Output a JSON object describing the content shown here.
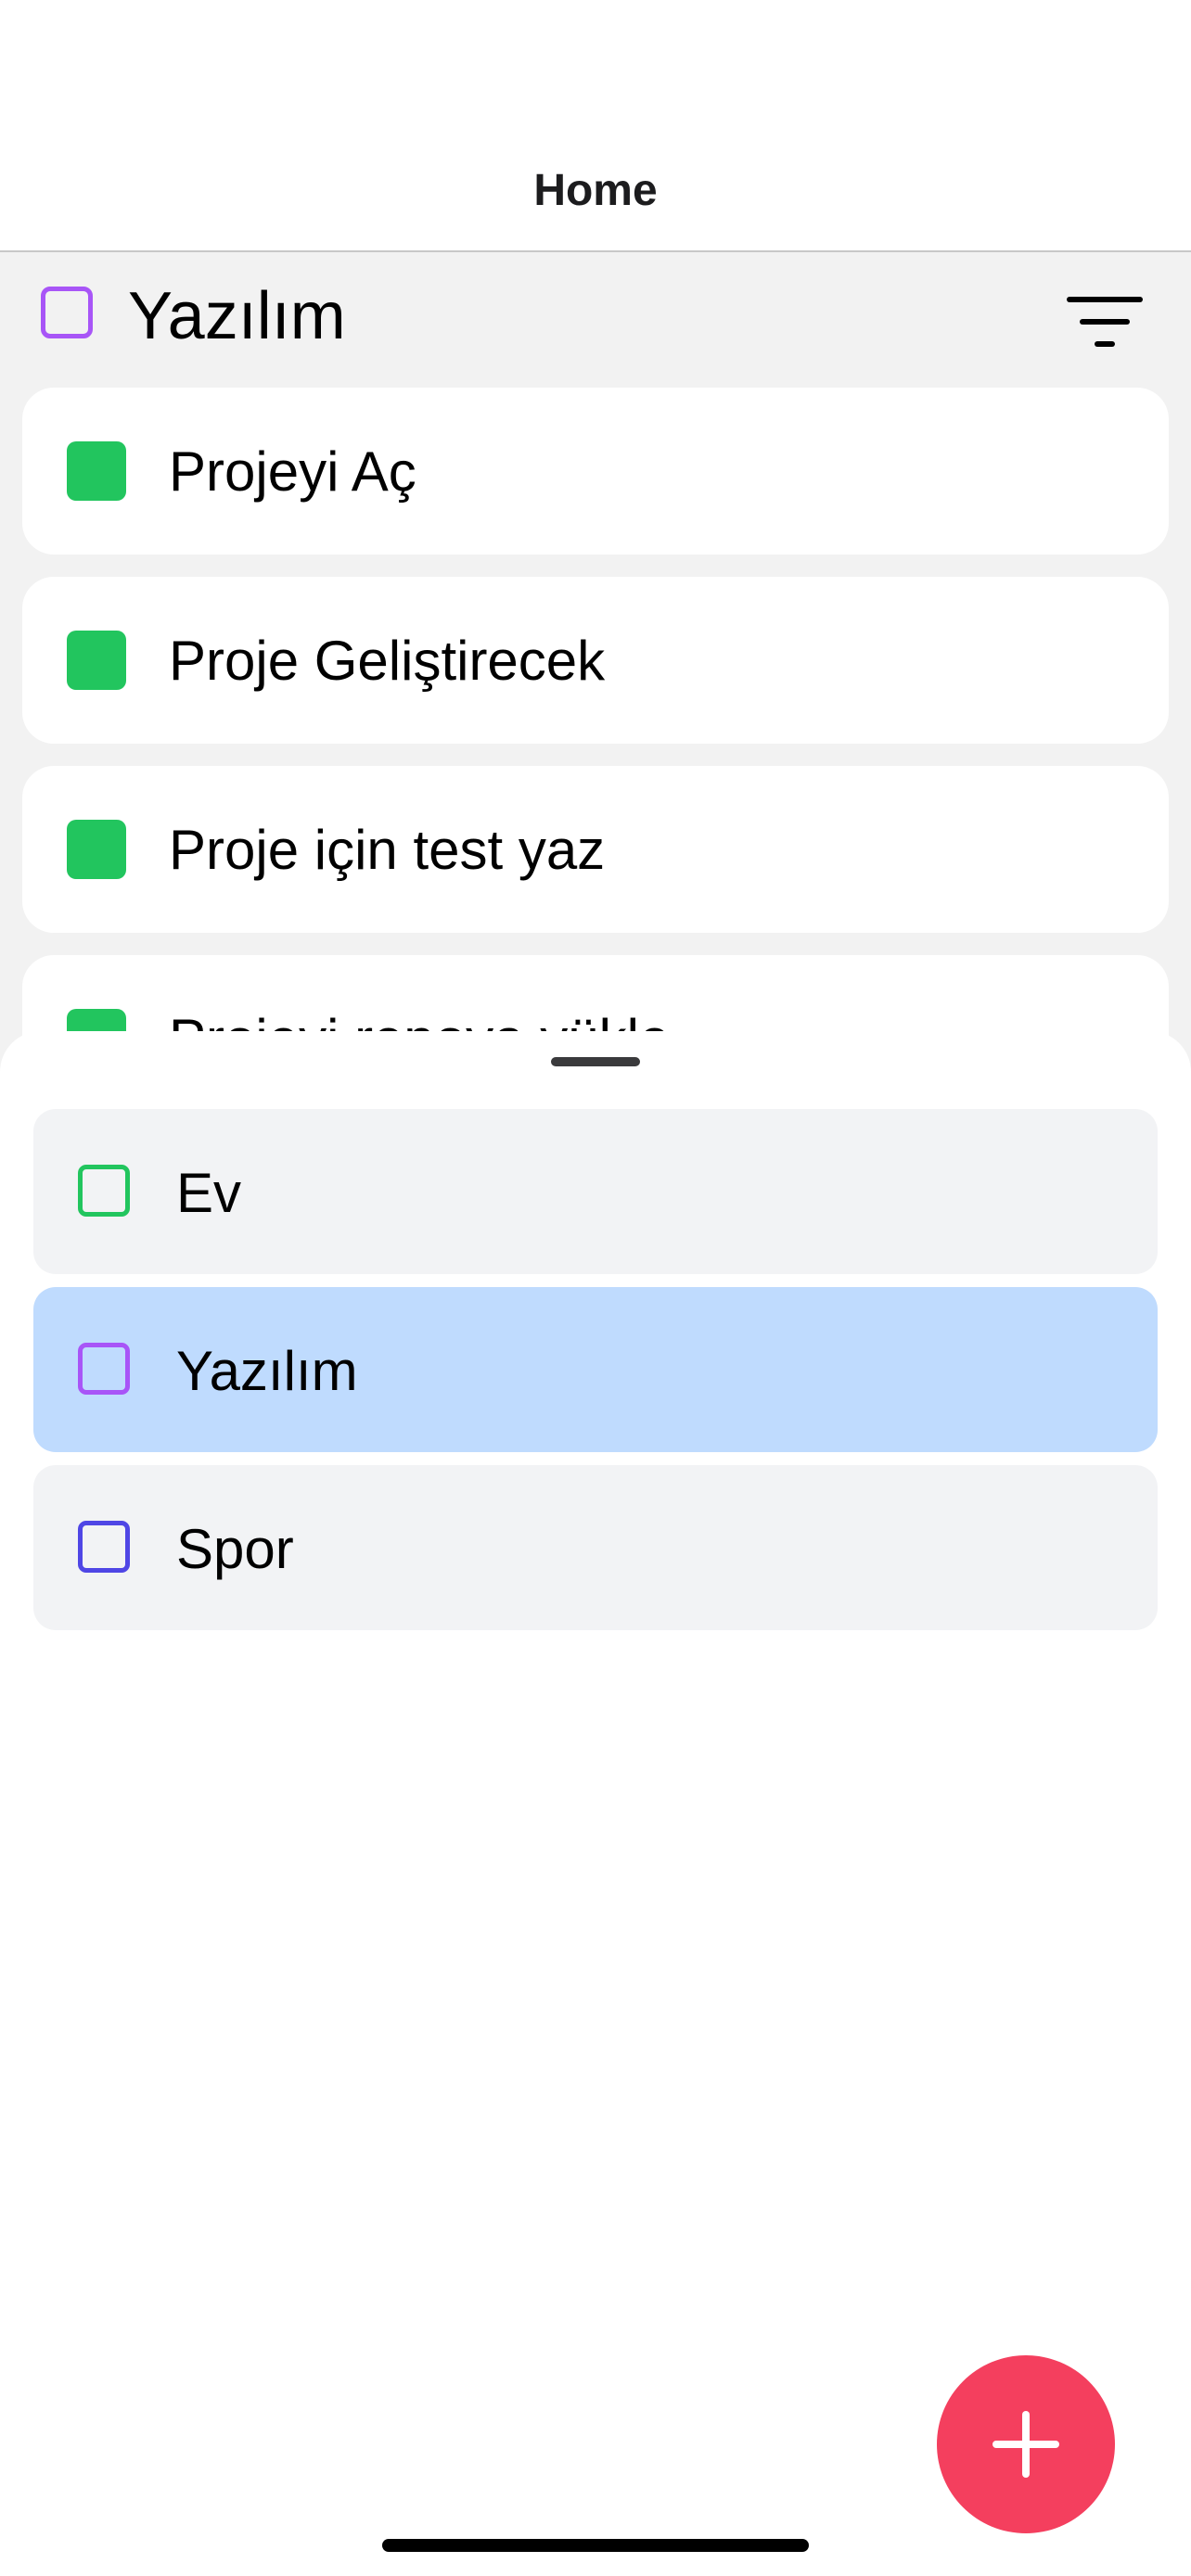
{
  "nav": {
    "title": "Home"
  },
  "category_header": {
    "title": "Yazılım",
    "icon_color": "#a855f7",
    "icon": "square-outline-icon"
  },
  "filter": {
    "icon": "filter-icon"
  },
  "tasks": [
    {
      "label": "Projeyi Aç",
      "color": "#22c55e"
    },
    {
      "label": "Proje Geliştirecek",
      "color": "#22c55e"
    },
    {
      "label": "Proje için test yaz",
      "color": "#22c55e"
    },
    {
      "label": "Projeyi repoya yükle",
      "color": "#22c55e"
    }
  ],
  "category_sheet": {
    "items": [
      {
        "label": "Ev",
        "color": "#22c55e",
        "selected": false
      },
      {
        "label": "Yazılım",
        "color": "#a855f7",
        "selected": true
      },
      {
        "label": "Spor",
        "color": "#4f46e5",
        "selected": false
      }
    ]
  },
  "fab": {
    "icon": "plus-icon",
    "color": "#f43f5e"
  }
}
